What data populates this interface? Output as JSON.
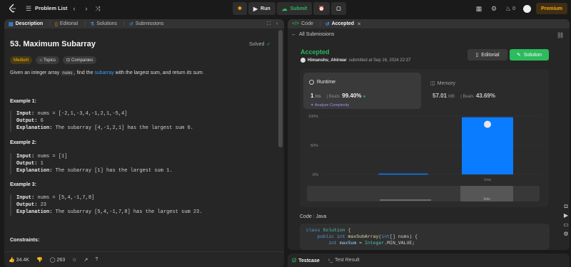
{
  "topbar": {
    "problem_list": "Problem List",
    "run_label": "Run",
    "submit_label": "Submit",
    "streak": "0",
    "premium_label": "Premium"
  },
  "left": {
    "tabs": [
      "Description",
      "Editorial",
      "Solutions",
      "Submissions"
    ],
    "title": "53. Maximum Subarray",
    "solved": "Solved",
    "chips": [
      "Medium",
      "Topics",
      "Companies"
    ],
    "desc": {
      "pre": "Given an integer array ",
      "code": "nums",
      "mid": ", find the ",
      "link": "subarray",
      "post1": " with the largest sum, and return ",
      "em": "its sum",
      "post2": "."
    },
    "examples": [
      {
        "title": "Example 1:",
        "input": "nums = [-2,1,-3,4,-1,2,1,-5,4]",
        "output": "6",
        "explanation": "The subarray [4,-1,2,1] has the largest sum 6."
      },
      {
        "title": "Example 2:",
        "input": "nums = [1]",
        "output": "1",
        "explanation": "The subarray [1] has the largest sum 1."
      },
      {
        "title": "Example 3:",
        "input": "nums = [5,4,-1,7,8]",
        "output": "23",
        "explanation": "The subarray [5,4,-1,7,8] has the largest sum 23."
      }
    ],
    "labels": {
      "input": "Input:",
      "output": "Output:",
      "explanation": "Explanation:"
    },
    "constraints": "Constraints:",
    "likes": "34.4K",
    "comments": "263"
  },
  "right": {
    "tabs": [
      "Code",
      "Accepted"
    ],
    "all_submissions": "All Submissions",
    "status": "Accepted",
    "user": "Himanshu_Ahirwar",
    "submitted": "submitted at Sep 16, 2024 22:37",
    "editorial_btn": "Editorial",
    "solution_btn": "Solution",
    "runtime_label": "Runtime",
    "runtime_value": "1",
    "runtime_unit": "ms",
    "runtime_beats_label": "Beats",
    "runtime_beats": "99.40%",
    "analyze": "Analyze Complexity",
    "memory_label": "Memory",
    "memory_value": "57.01",
    "memory_unit": "MB",
    "memory_beats_label": "Beats",
    "memory_beats": "43.69%",
    "code_lang_label": "Code",
    "code_lang": "Java",
    "code_lines": [
      "class Solution {",
      "    public int maxSubArray(int[] nums) {",
      "        int maxSum = Integer.MIN_VALUE;"
    ],
    "bottom_tabs": [
      "Testcase",
      "Test Result"
    ]
  },
  "chart_data": {
    "type": "bar",
    "categories": [
      "0ms",
      "1ms"
    ],
    "values": [
      1.5,
      98
    ],
    "ylabels": [
      "100%",
      "50%",
      "0%"
    ],
    "ylim": [
      0,
      100
    ],
    "xlabel_selected": "1ms",
    "colors": {
      "bar": "#0a7cff",
      "grid": "#3a3a3a"
    }
  }
}
